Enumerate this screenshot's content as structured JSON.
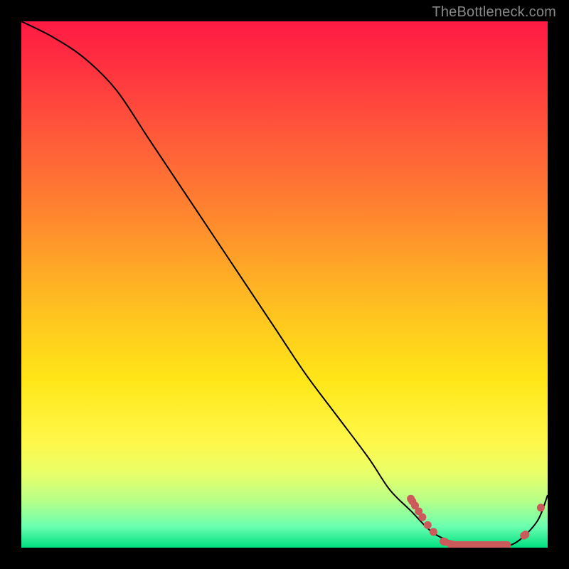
{
  "watermark": "TheBottleneck.com",
  "chart_data": {
    "type": "line",
    "title": "",
    "xlabel": "",
    "ylabel": "",
    "xlim": [
      0,
      100
    ],
    "ylim": [
      0,
      100
    ],
    "series": [
      {
        "name": "curve",
        "x": [
          0,
          6,
          12,
          18,
          24,
          30,
          36,
          42,
          48,
          54,
          60,
          66,
          70,
          74,
          78,
          82,
          86,
          90,
          94,
          98,
          100
        ],
        "y": [
          100,
          97,
          93,
          87,
          78,
          69,
          60,
          51,
          42,
          33,
          25,
          17,
          11,
          7,
          3,
          1,
          0,
          0,
          1,
          5,
          10
        ]
      }
    ],
    "markers": [
      {
        "x": 74.0,
        "y": 9.3
      },
      {
        "x": 74.3,
        "y": 8.8
      },
      {
        "x": 74.8,
        "y": 8.0
      },
      {
        "x": 75.5,
        "y": 6.9
      },
      {
        "x": 76.2,
        "y": 5.8
      },
      {
        "x": 77.2,
        "y": 4.3
      },
      {
        "x": 78.3,
        "y": 3.0
      },
      {
        "x": 80.2,
        "y": 1.2
      },
      {
        "x": 80.5,
        "y": 1.1
      },
      {
        "x": 81.5,
        "y": 0.7
      },
      {
        "x": 82.0,
        "y": 0.6
      },
      {
        "x": 82.5,
        "y": 0.5
      },
      {
        "x": 83.0,
        "y": 0.5
      },
      {
        "x": 83.5,
        "y": 0.5
      },
      {
        "x": 84.0,
        "y": 0.5
      },
      {
        "x": 84.5,
        "y": 0.5
      },
      {
        "x": 85.0,
        "y": 0.5
      },
      {
        "x": 85.5,
        "y": 0.5
      },
      {
        "x": 86.0,
        "y": 0.5
      },
      {
        "x": 86.5,
        "y": 0.5
      },
      {
        "x": 87.0,
        "y": 0.5
      },
      {
        "x": 87.5,
        "y": 0.5
      },
      {
        "x": 88.0,
        "y": 0.5
      },
      {
        "x": 88.5,
        "y": 0.5
      },
      {
        "x": 89.0,
        "y": 0.5
      },
      {
        "x": 89.5,
        "y": 0.5
      },
      {
        "x": 90.0,
        "y": 0.5
      },
      {
        "x": 90.5,
        "y": 0.5
      },
      {
        "x": 91.0,
        "y": 0.5
      },
      {
        "x": 91.5,
        "y": 0.5
      },
      {
        "x": 92.0,
        "y": 0.5
      },
      {
        "x": 92.3,
        "y": 0.5
      },
      {
        "x": 95.5,
        "y": 2.3
      },
      {
        "x": 95.8,
        "y": 2.5
      },
      {
        "x": 98.7,
        "y": 7.6
      }
    ],
    "gradient_stops": [
      {
        "pos": 0,
        "color": "#ff1a44"
      },
      {
        "pos": 8,
        "color": "#ff3040"
      },
      {
        "pos": 22,
        "color": "#ff5a3a"
      },
      {
        "pos": 38,
        "color": "#ff8a2e"
      },
      {
        "pos": 55,
        "color": "#ffc220"
      },
      {
        "pos": 68,
        "color": "#ffe618"
      },
      {
        "pos": 80,
        "color": "#fff84a"
      },
      {
        "pos": 86,
        "color": "#e8ff6a"
      },
      {
        "pos": 91,
        "color": "#b8ff88"
      },
      {
        "pos": 96,
        "color": "#6affb0"
      },
      {
        "pos": 100,
        "color": "#00e080"
      }
    ]
  },
  "colors": {
    "background": "#000000",
    "curve": "#000000",
    "marker": "#cc5a5a"
  }
}
